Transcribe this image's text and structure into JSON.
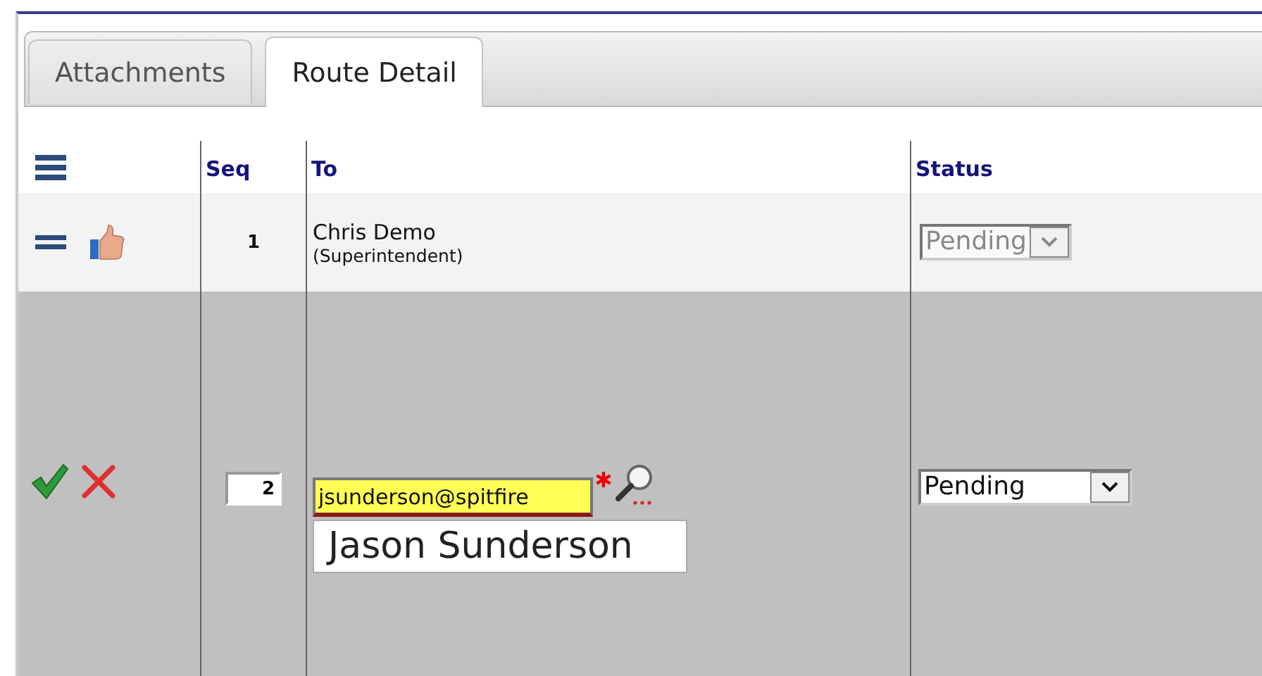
{
  "tabs": [
    {
      "label": "Attachments",
      "selected": false
    },
    {
      "label": "Route Detail",
      "selected": true
    }
  ],
  "table": {
    "columns": [
      "Seq",
      "To",
      "Status"
    ],
    "rows": [
      {
        "kind": "view",
        "seq": "1",
        "name": "Chris Demo",
        "role": "(Superintendent)",
        "status": {
          "value": "Pending",
          "disabled": true
        }
      },
      {
        "kind": "edit",
        "seq": "2",
        "to": {
          "value": "jsunderson@spitfire",
          "required": true
        },
        "suggestion": "Jason Sunderson",
        "status": {
          "value": "Pending",
          "disabled": false
        }
      }
    ]
  }
}
